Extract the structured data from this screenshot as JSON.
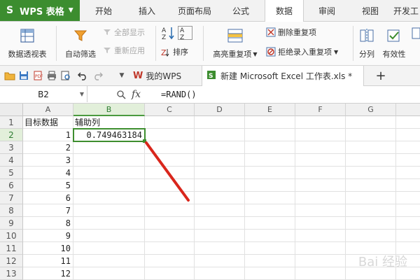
{
  "app": {
    "name": "WPS 表格",
    "logo_letter": "S"
  },
  "menu_tabs": [
    "开始",
    "插入",
    "页面布局",
    "公式",
    "数据",
    "审阅",
    "视图",
    "开发工"
  ],
  "active_menu_tab": "数据",
  "ribbon": {
    "pivot_table": "数据透视表",
    "auto_filter": "自动筛选",
    "show_all": "全部显示",
    "reapply": "重新应用",
    "sort": "排序",
    "highlight_duplicates": "高亮重复项",
    "remove_duplicates": "删除重复项",
    "reject_duplicates": "拒绝录入重复项",
    "split_column": "分列",
    "validation": "有效性"
  },
  "doc_tabs": {
    "my_wps": "我的WPS",
    "file": "新建 Microsoft Excel 工作表.xls *",
    "new_tab": "+"
  },
  "formula_bar": {
    "cell_ref": "B2",
    "fx": "fx",
    "formula": "=RAND()"
  },
  "grid": {
    "columns": [
      "A",
      "B",
      "C",
      "D",
      "E",
      "F",
      "G"
    ],
    "selected_column": "B",
    "rows": [
      "1",
      "2",
      "3",
      "4",
      "5",
      "6",
      "7",
      "8",
      "9",
      "10",
      "11",
      "12",
      "13"
    ],
    "selected_row": "2",
    "header_row": {
      "a1": "目标数据",
      "b1": "辅助列"
    },
    "col_a_values": [
      "1",
      "2",
      "3",
      "4",
      "5",
      "6",
      "7",
      "8",
      "9",
      "10",
      "11",
      "12"
    ],
    "b2_value": "0.749463184"
  },
  "watermark": "Bai 经验",
  "colors": {
    "brand": "#3c8d2f",
    "selection": "#3e8e2f",
    "annotation_arrow": "#d9261c"
  }
}
